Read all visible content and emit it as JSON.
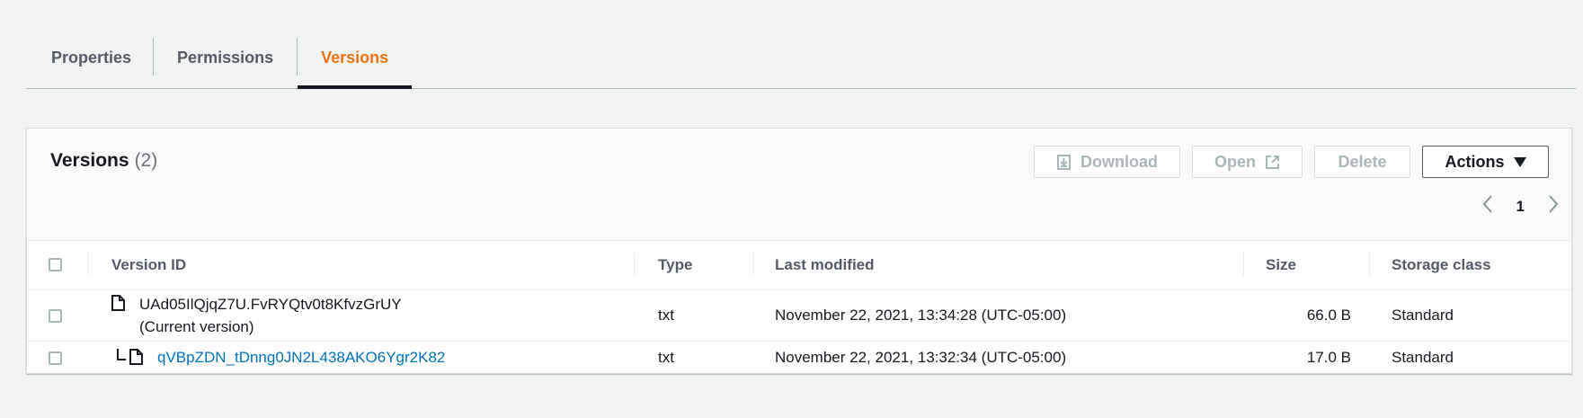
{
  "tabs": [
    {
      "label": "Properties",
      "active": false
    },
    {
      "label": "Permissions",
      "active": false
    },
    {
      "label": "Versions",
      "active": true
    }
  ],
  "panel": {
    "title": "Versions",
    "count": "(2)",
    "buttons": {
      "download": "Download",
      "open": "Open",
      "delete": "Delete",
      "actions": "Actions"
    },
    "pager": {
      "page": "1"
    }
  },
  "table": {
    "columns": [
      "Version ID",
      "Type",
      "Last modified",
      "Size",
      "Storage class"
    ],
    "rows": [
      {
        "version_id": "UAd05IlQjqZ7U.FvRYQtv0t8KfvzGrUY",
        "note": "(Current version)",
        "type": "txt",
        "last_modified": "November 22, 2021, 13:34:28 (UTC-05:00)",
        "size": "66.0 B",
        "storage_class": "Standard"
      },
      {
        "version_id": "qVBpZDN_tDnng0JN2L438AKO6Ygr2K82",
        "type": "txt",
        "last_modified": "November 22, 2021, 13:32:34 (UTC-05:00)",
        "size": "17.0 B",
        "storage_class": "Standard"
      }
    ]
  },
  "colors": {
    "accent": "#ec7211",
    "link": "#0073bb",
    "disabled": "#aab7b8"
  }
}
